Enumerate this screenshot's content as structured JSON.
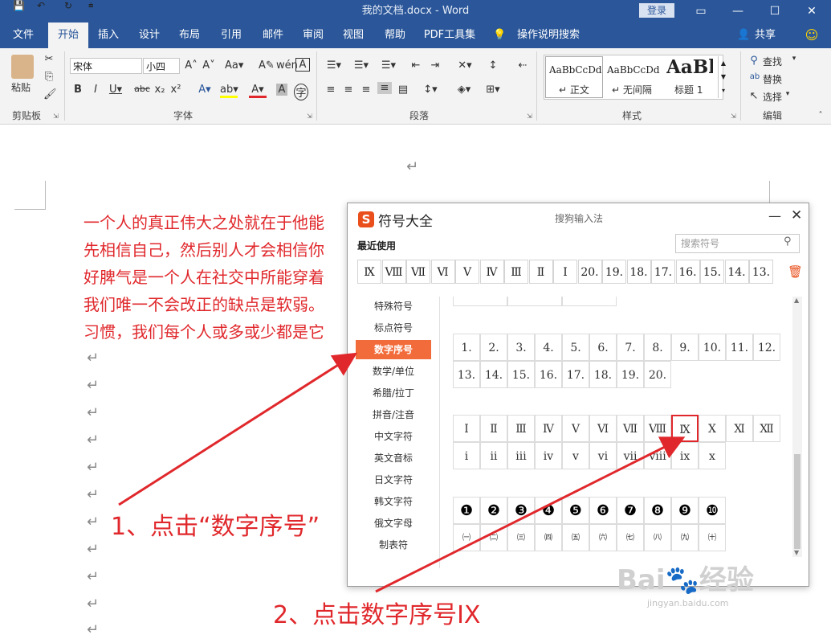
{
  "titlebar": {
    "doc_title": "我的文档.docx  -  Word",
    "login": "登录",
    "qa_save": "💾",
    "qa_undo": "↶",
    "qa_redo": "↻",
    "qa_more": "⩧"
  },
  "tabs": [
    "文件",
    "开始",
    "插入",
    "设计",
    "布局",
    "引用",
    "邮件",
    "审阅",
    "视图",
    "帮助",
    "PDF工具集"
  ],
  "tell_me": "操作说明搜索",
  "share": "共享",
  "ribbon": {
    "paste": "粘贴",
    "group_clipboard": "剪贴板",
    "font_name": "宋体",
    "font_size": "小四",
    "group_font": "字体",
    "group_paragraph": "段落",
    "styles": [
      {
        "sample": "AaBbCcDd",
        "name": "↵ 正文"
      },
      {
        "sample": "AaBbCcDd",
        "name": "↵ 无间隔"
      },
      {
        "sample": "AaBl",
        "name": "标题 1"
      }
    ],
    "group_styles": "样式",
    "find": "查找",
    "replace": "替换",
    "select": "选择",
    "group_edit": "编辑"
  },
  "document": {
    "lines": [
      "一个人的真正伟大之处就在于他能",
      "先相信自己，然后别人才会相信你",
      "好脾气是一个人在社交中所能穿着",
      "我们唯一不会改正的缺点是软弱。",
      "习惯，我们每个人或多或少都是它"
    ],
    "para_mark": "↵"
  },
  "dialog": {
    "title": "符号大全",
    "subtitle": "搜狗输入法",
    "recent_label": "最近使用",
    "search_placeholder": "搜索符号",
    "recent": [
      "Ⅸ",
      "Ⅷ",
      "Ⅶ",
      "Ⅵ",
      "Ⅴ",
      "Ⅳ",
      "Ⅲ",
      "Ⅱ",
      "Ⅰ",
      "20.",
      "19.",
      "18.",
      "17.",
      "16.",
      "15.",
      "14.",
      "13."
    ],
    "categories": [
      "特殊符号",
      "标点符号",
      "数字序号",
      "数学/单位",
      "希腊/拉丁",
      "拼音/注音",
      "中文字符",
      "英文音标",
      "日文字符",
      "韩文字符",
      "俄文字母",
      "制表符"
    ],
    "active_category": "数字序号",
    "grid_dot_row1": [
      "1.",
      "2.",
      "3.",
      "4.",
      "5.",
      "6.",
      "7.",
      "8.",
      "9.",
      "10.",
      "11.",
      "12."
    ],
    "grid_dot_row2": [
      "13.",
      "14.",
      "15.",
      "16.",
      "17.",
      "18.",
      "19.",
      "20."
    ],
    "grid_roman_upper": [
      "Ⅰ",
      "Ⅱ",
      "Ⅲ",
      "Ⅳ",
      "Ⅴ",
      "Ⅵ",
      "Ⅶ",
      "Ⅷ",
      "Ⅸ",
      "Ⅹ",
      "Ⅺ",
      "Ⅻ"
    ],
    "grid_roman_lower": [
      "ⅰ",
      "ⅱ",
      "ⅲ",
      "ⅳ",
      "ⅴ",
      "ⅵ",
      "ⅶ",
      "ⅷ",
      "ⅸ",
      "ⅹ"
    ],
    "grid_circled": [
      "❶",
      "❷",
      "❸",
      "❹",
      "❺",
      "❻",
      "❼",
      "❽",
      "❾",
      "❿"
    ],
    "grid_paren": [
      "㈠",
      "㈡",
      "㈢",
      "㈣",
      "㈤",
      "㈥",
      "㈦",
      "㈧",
      "㈨",
      "㈩"
    ],
    "selected_symbol": "Ⅸ"
  },
  "annotations": {
    "step1": "1、点击“数字序号”",
    "step2": "2、点击数字序号IX"
  },
  "watermark": "Bai🐾经验",
  "watermark_url": "jingyan.baidu.com",
  "colors": {
    "word_blue": "#2b579a",
    "accent_orange": "#f26b3a",
    "annotation_red": "#e0282c"
  }
}
